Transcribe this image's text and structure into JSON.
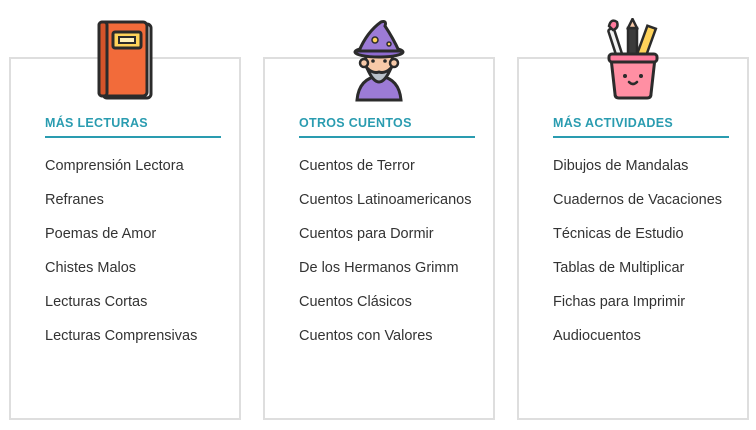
{
  "columns": [
    {
      "icon": "book-icon",
      "title": "MÁS LECTURAS",
      "links": [
        "Comprensión Lectora",
        "Refranes",
        "Poemas de Amor",
        "Chistes Malos",
        "Lecturas Cortas",
        "Lecturas Comprensivas"
      ]
    },
    {
      "icon": "wizard-icon",
      "title": "OTROS CUENTOS",
      "links": [
        "Cuentos de Terror",
        "Cuentos Latinoamericanos",
        "Cuentos para Dormir",
        "De los Hermanos Grimm",
        "Cuentos Clásicos",
        "Cuentos con Valores"
      ]
    },
    {
      "icon": "pencil-cup-icon",
      "title": "MÁS ACTIVIDADES",
      "links": [
        "Dibujos de Mandalas",
        "Cuadernos de Vacaciones",
        "Técnicas de Estudio",
        "Tablas de Multiplicar",
        "Fichas para Imprimir",
        "Audiocuentos"
      ]
    }
  ],
  "colors": {
    "accent": "#2a9cb0",
    "text": "#333333",
    "border": "#dedede"
  }
}
